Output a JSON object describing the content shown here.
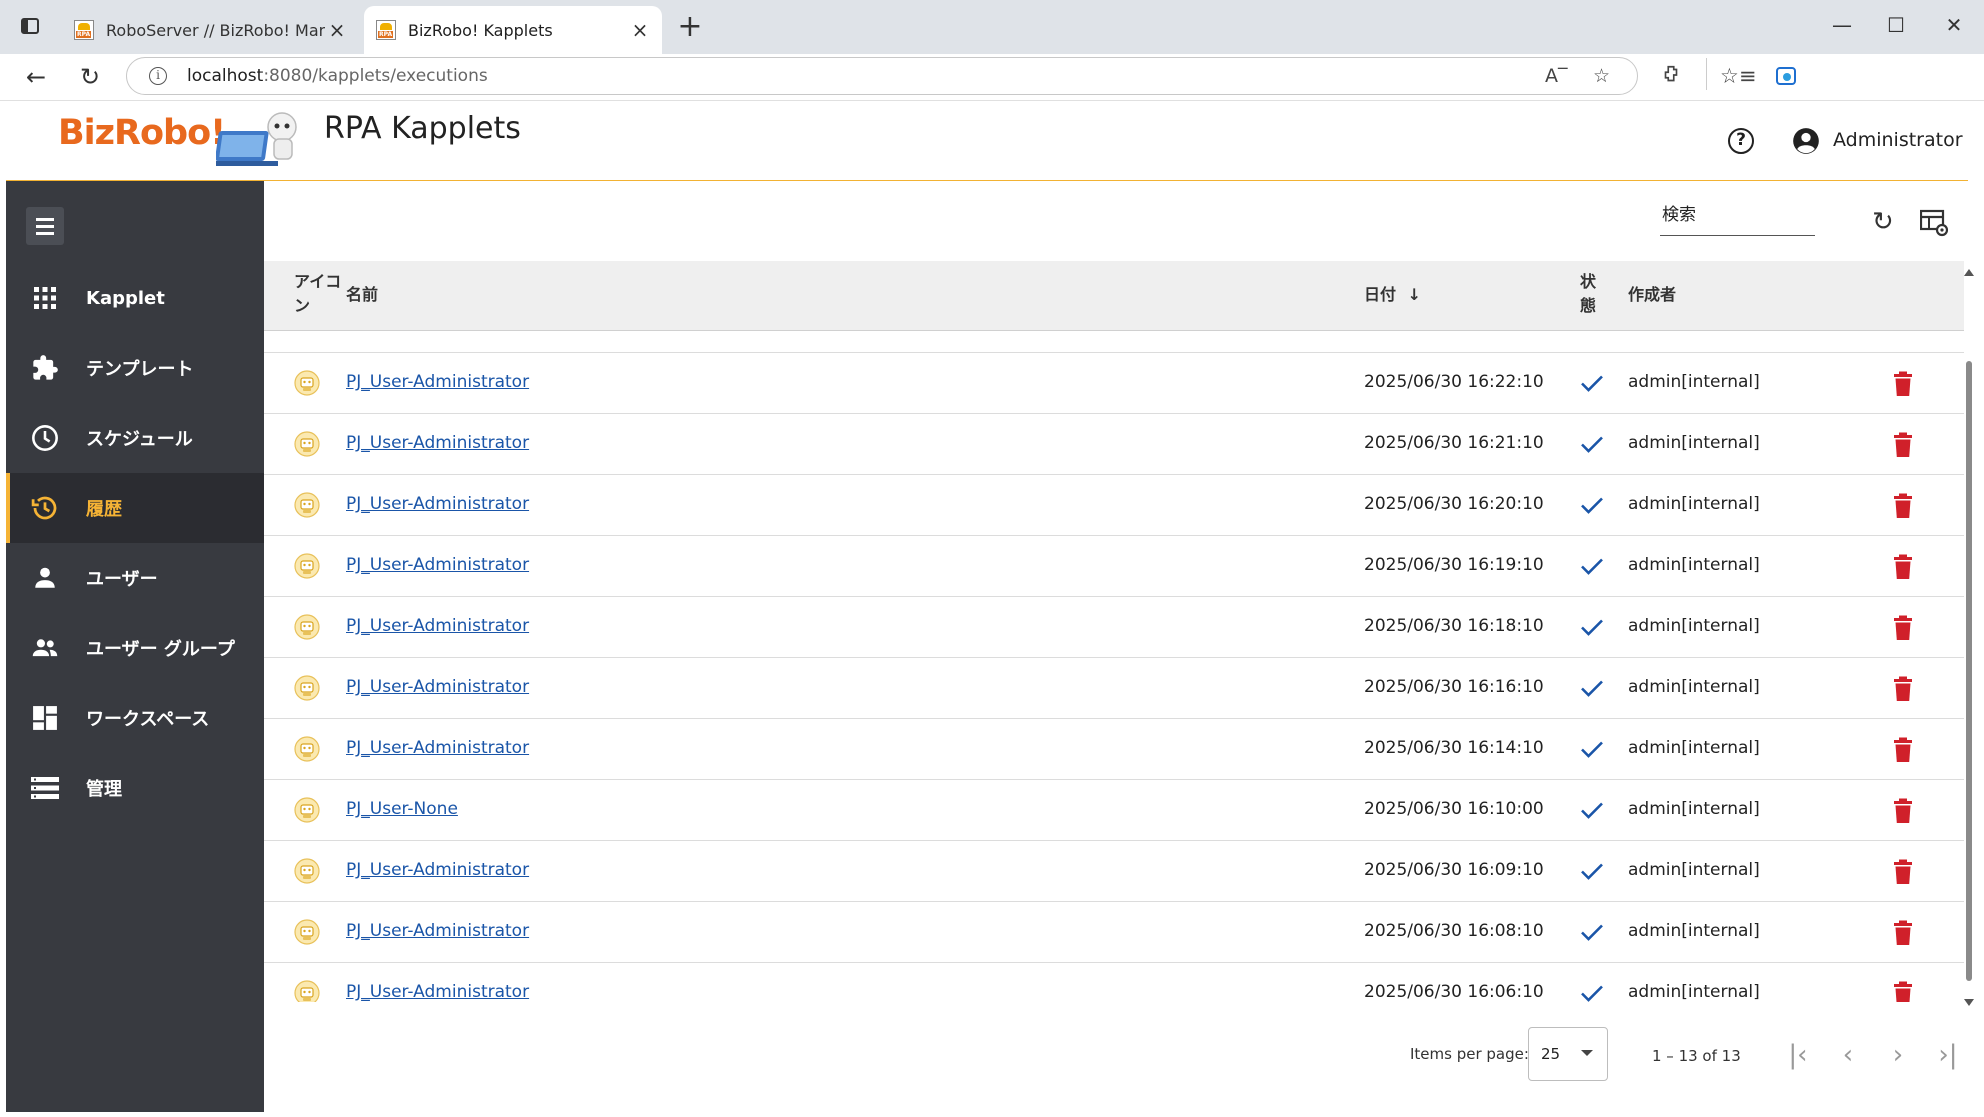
{
  "browser": {
    "tabs": [
      {
        "title": "RoboServer // BizRobo! Managem",
        "close": "×"
      },
      {
        "title": "BizRobo! Kapplets",
        "close": "×"
      }
    ],
    "new_tab": "+",
    "url_host": "localhost",
    "url_path": ":8080/kapplets/executions"
  },
  "app": {
    "logo_text": "BizRobo!",
    "title": "RPA Kapplets",
    "user": "Administrator",
    "accent": "#f5b335"
  },
  "sidebar": {
    "items": [
      {
        "label": "Kapplet",
        "icon": "apps-grid-icon",
        "active": false
      },
      {
        "label": "テンプレート",
        "icon": "puzzle-icon",
        "active": false
      },
      {
        "label": "スケジュール",
        "icon": "clock-icon",
        "active": false
      },
      {
        "label": "履歴",
        "icon": "history-icon",
        "active": true
      },
      {
        "label": "ユーザー",
        "icon": "person-icon",
        "active": false
      },
      {
        "label": "ユーザー グループ",
        "icon": "people-icon",
        "active": false
      },
      {
        "label": "ワークスペース",
        "icon": "dashboard-icon",
        "active": false
      },
      {
        "label": "管理",
        "icon": "list-icon",
        "active": false
      }
    ]
  },
  "toolbar": {
    "search_placeholder": "検索"
  },
  "table": {
    "headers": {
      "icon": "アイコン",
      "name": "名前",
      "date": "日付",
      "status": "状態",
      "author": "作成者"
    },
    "rows": [
      {
        "name": "PJ_User-Administrator",
        "date": "2025/06/30 16:22:10",
        "author": "admin[internal]"
      },
      {
        "name": "PJ_User-Administrator",
        "date": "2025/06/30 16:21:10",
        "author": "admin[internal]"
      },
      {
        "name": "PJ_User-Administrator",
        "date": "2025/06/30 16:20:10",
        "author": "admin[internal]"
      },
      {
        "name": "PJ_User-Administrator",
        "date": "2025/06/30 16:19:10",
        "author": "admin[internal]"
      },
      {
        "name": "PJ_User-Administrator",
        "date": "2025/06/30 16:18:10",
        "author": "admin[internal]"
      },
      {
        "name": "PJ_User-Administrator",
        "date": "2025/06/30 16:16:10",
        "author": "admin[internal]"
      },
      {
        "name": "PJ_User-Administrator",
        "date": "2025/06/30 16:14:10",
        "author": "admin[internal]"
      },
      {
        "name": "PJ_User-None",
        "date": "2025/06/30 16:10:00",
        "author": "admin[internal]"
      },
      {
        "name": "PJ_User-Administrator",
        "date": "2025/06/30 16:09:10",
        "author": "admin[internal]"
      },
      {
        "name": "PJ_User-Administrator",
        "date": "2025/06/30 16:08:10",
        "author": "admin[internal]"
      },
      {
        "name": "PJ_User-Administrator",
        "date": "2025/06/30 16:06:10",
        "author": "admin[internal]"
      }
    ]
  },
  "paginator": {
    "items_per_page_label": "Items per page:",
    "items_per_page": "25",
    "range": "1 – 13 of 13"
  },
  "colors": {
    "sidebar_bg": "#383a40",
    "link": "#1a55a8",
    "status_ok": "#1a55a8",
    "delete": "#d0202a",
    "logo": "#e8691e"
  }
}
